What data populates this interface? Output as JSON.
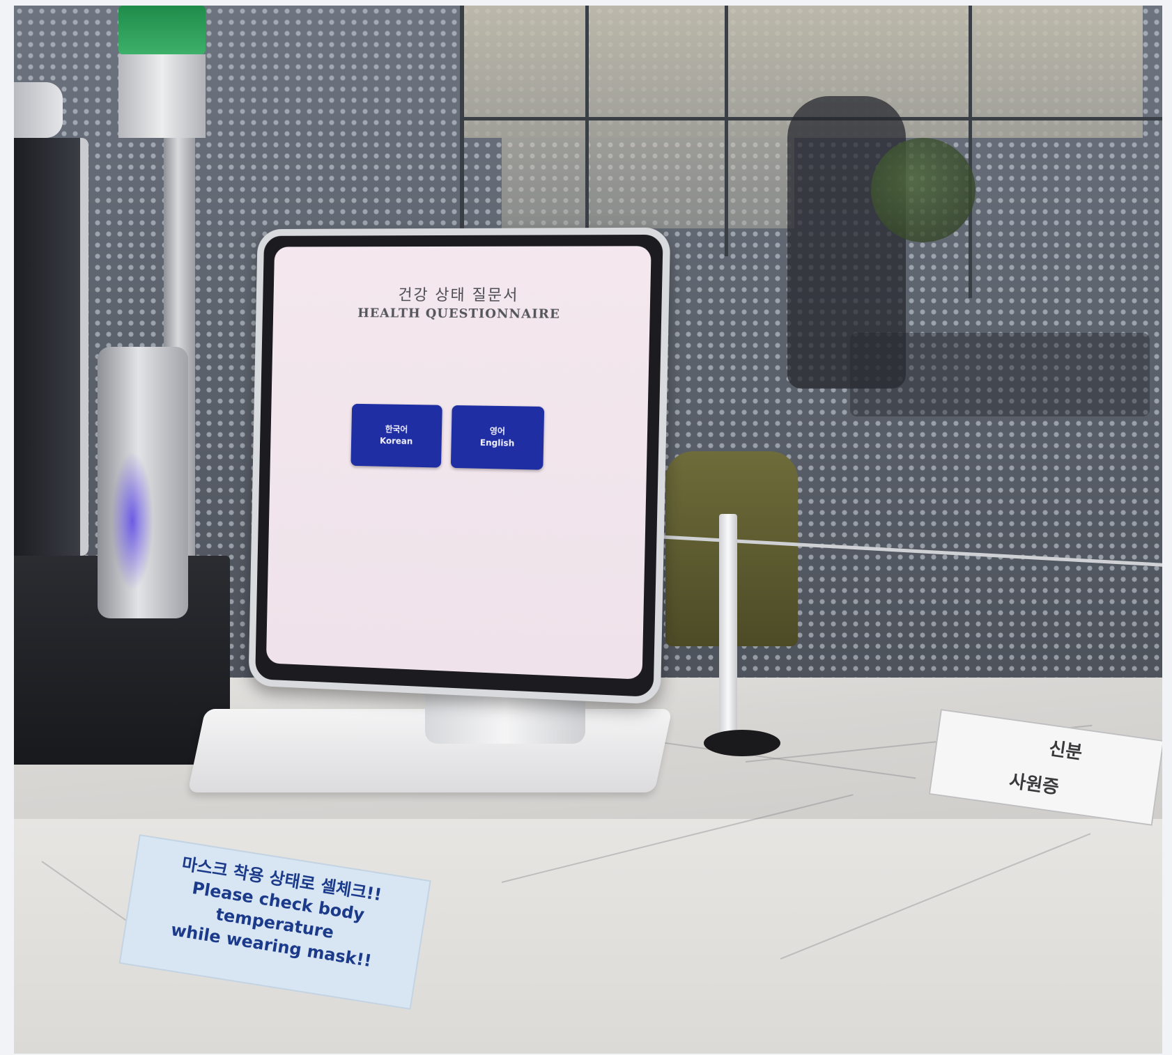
{
  "tablet": {
    "title_ko": "건강 상태 질문서",
    "title_en": "HEALTH QUESTIONNAIRE",
    "prompt_line1": "",
    "prompt_line2": "",
    "buttons": [
      {
        "label_ko": "한국어",
        "label_en": "Korean"
      },
      {
        "label_ko": "영어",
        "label_en": "English"
      }
    ],
    "button_color": "#1f2ea3"
  },
  "sticker": {
    "line1": "마스크 착용 상태로 셀체크!!",
    "line2": "Please check body temperature",
    "line3": "while wearing mask!!"
  },
  "desk_card": {
    "line1": "신분",
    "line2": "사원증"
  }
}
